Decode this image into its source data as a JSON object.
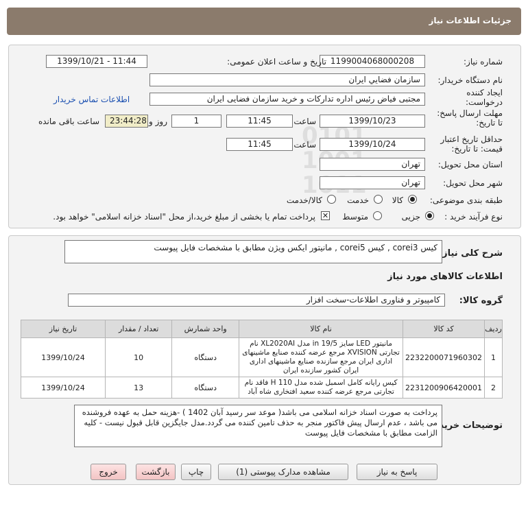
{
  "header": {
    "title": "جزئیات اطلاعات نیاز"
  },
  "labels": {
    "need_number": "شماره نیاز:",
    "announce_datetime": "تاریخ و ساعت اعلان عمومی:",
    "buyer_org": "نام دستگاه خریدار:",
    "requester": "ایجاد کننده درخواست:",
    "reply_deadline": "مهلت ارسال پاسخ: تا تاریخ:",
    "time": "ساعت",
    "day_and": "روز و",
    "remaining": "ساعت باقی مانده",
    "price_validity": "حداقل تاریخ اعتبار قیمت: تا تاریخ:",
    "delivery_province": "استان محل تحویل:",
    "delivery_city": "شهر محل تحویل:",
    "category": "طبقه بندی موضوعی:",
    "purchase_type": "نوع فرآیند خرید :",
    "general_desc": "شرح کلی نیاز:",
    "goods_info": "اطلاعات کالاهای مورد نیاز",
    "goods_group": "گروه کالا:",
    "buyer_notes": "توضیحات خریدار:"
  },
  "fields": {
    "need_number": "1199004068000208",
    "announce_datetime": "1399/10/21 - 11:44",
    "buyer_org": "سازمان فضايي ايران",
    "requester": "مجتبی  فیاض رئیس اداره تدارکات و خرید سازمان فضایی ایران",
    "contact_link": "اطلاعات تماس خریدار",
    "reply_date": "1399/10/23",
    "reply_time": "11:45",
    "reply_days": "1",
    "reply_remaining": "23:44:28",
    "validity_date": "1399/10/24",
    "validity_time": "11:45",
    "province": "تهران",
    "city": "تهران"
  },
  "category_options": {
    "goods": "کالا",
    "service": "خدمت",
    "goods_service": "کالا/خدمت"
  },
  "purchase_options": {
    "minor": "جزیی",
    "medium": "متوسط",
    "treasury_note": "پرداخت تمام یا بخشی از مبلغ خرید،از محل \"اسناد خزانه اسلامی\" خواهد بود."
  },
  "general_desc": "کیس corei3  ,  کیس corei5  , مانیتور ایکس ویژن مطابق با مشخصات فایل پیوست",
  "goods_group": "کامپیوتر و فناوری اطلاعات-سخت افزار",
  "table": {
    "headers": [
      "ردیف",
      "کد کالا",
      "نام کالا",
      "واحد شمارش",
      "تعداد / مقدار",
      "تاریخ نیاز"
    ],
    "rows": [
      {
        "index": "1",
        "code": "2232200071960302",
        "name": "مانیتور LED سایز 19/5 in مدل XL2020AI نام تجارتی XVISION مرجع عرضه کننده صنایع ماشینهای اداری ایران مرجع سازنده صنایع ماشینهای اداری ایران کشور سازنده ایران",
        "unit": "دستگاه",
        "qty": "10",
        "date": "1399/10/24"
      },
      {
        "index": "2",
        "code": "2231200906420001",
        "name": "کیس رایانه کامل اسمبل شده مدل H 110 فاقد نام تجارتی مرجع عرضه کننده سعید افتخاری شاه آباد",
        "unit": "دستگاه",
        "qty": "13",
        "date": "1399/10/24"
      }
    ]
  },
  "buyer_notes": "پرداخت به صورت اسناد خزانه اسلامی می باشد( موعد سر رسید آبان 1402 ) -هزینه حمل به عهده فروشنده می باشد ، عدم ارسال پیش فاکتور منجر به حذف تامین کننده می گردد.مدل جایگزین قابل قبول نیست - کلیه الزامت مطابق با مشخصات فایل پیوست",
  "buttons": {
    "reply": "پاسخ به نیاز",
    "attachments": "مشاهده مدارک پیوستی (1)",
    "print": "چاپ",
    "back": "بازگشت",
    "exit": "خروج"
  },
  "colors": {
    "header_bg": "#8b7b6c",
    "timer_bg": "#f1edc8",
    "link": "#1a4fb0",
    "pink_button": "#f3c4c4"
  },
  "watermark": {
    "text": "ParsNamadData"
  }
}
